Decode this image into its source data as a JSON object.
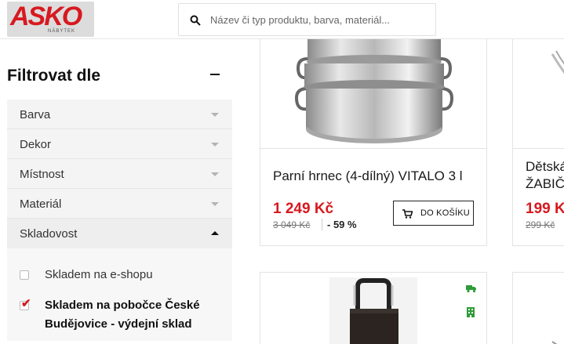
{
  "header": {
    "logo_text": "ASKO",
    "logo_sub": "NÁBYTEK",
    "search_placeholder": "Název či typ produktu, barva, materiál..."
  },
  "sidebar": {
    "title": "Filtrovat dle",
    "filters": [
      {
        "label": "Barva"
      },
      {
        "label": "Dekor"
      },
      {
        "label": "Místnost"
      },
      {
        "label": "Materiál"
      },
      {
        "label": "Skladovost"
      }
    ],
    "stock_options": [
      {
        "label": "Skladem na e-shopu",
        "checked": false
      },
      {
        "label": "Skladem na pobočce České Budějovice - výdejní sklad",
        "checked": true
      }
    ]
  },
  "products": [
    {
      "name": "Parní hrnec (4-dílný) VITALO 3 l",
      "price": "1 249 Kč",
      "old_price": "3 049 Kč",
      "discount": "- 59 %",
      "cart_label": "DO KOŠÍKU"
    },
    {
      "name_line1": "Dětská",
      "name_line2": "ŽABIČ",
      "price": "199 K",
      "old_price": "299 Kč"
    }
  ],
  "colors": {
    "accent": "#d71920",
    "stock_icon": "#2e9c3a"
  }
}
